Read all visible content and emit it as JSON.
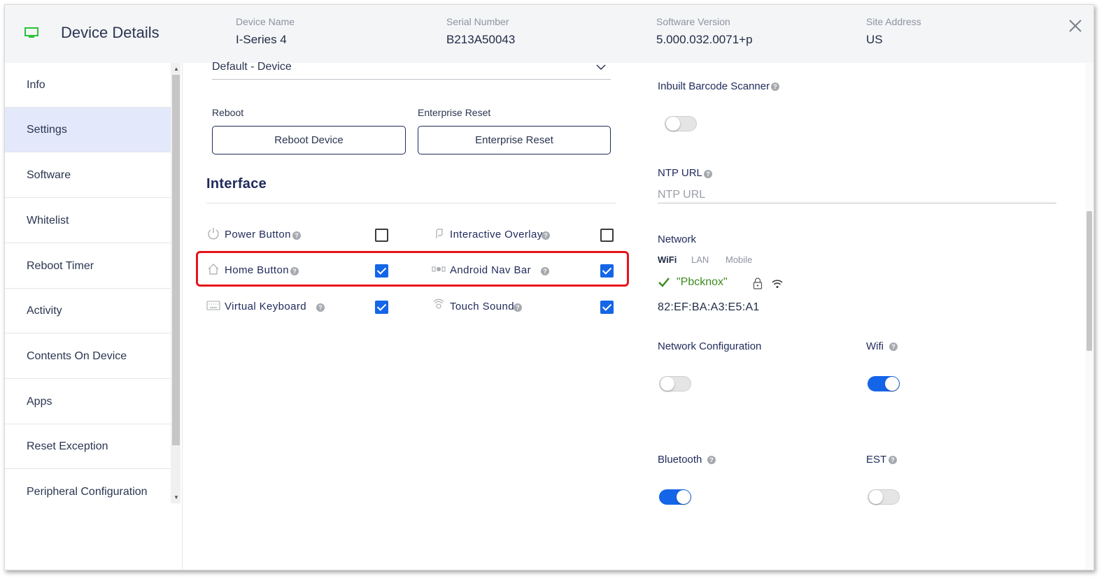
{
  "header": {
    "title": "Device Details",
    "fields": [
      {
        "label": "Device Name",
        "value": "I-Series 4"
      },
      {
        "label": "Serial Number",
        "value": "B213A50043"
      },
      {
        "label": "Software Version",
        "value": "5.000.032.0071+p"
      },
      {
        "label": "Site Address",
        "value": "US"
      }
    ],
    "icon_color": "#2cc33a"
  },
  "sidebar": {
    "items": [
      {
        "label": "Info"
      },
      {
        "label": "Settings",
        "active": true
      },
      {
        "label": "Software"
      },
      {
        "label": "Whitelist"
      },
      {
        "label": "Reboot Timer"
      },
      {
        "label": "Activity"
      },
      {
        "label": "Contents On Device"
      },
      {
        "label": "Apps"
      },
      {
        "label": "Reset Exception"
      },
      {
        "label": "Peripheral Configuration"
      }
    ]
  },
  "settings": {
    "profile_value": "Default - Device",
    "reboot_label": "Reboot",
    "reboot_button": "Reboot Device",
    "enterprise_label": "Enterprise Reset",
    "enterprise_button": "Enterprise Reset"
  },
  "interface": {
    "title": "Interface",
    "options": [
      {
        "label": "Power Button",
        "icon": "power-icon",
        "checked": false
      },
      {
        "label": "Interactive Overlay",
        "icon": "overlay-icon",
        "checked": false
      },
      {
        "label": "Home Button",
        "icon": "home-icon",
        "checked": true
      },
      {
        "label": "Android Nav Bar",
        "icon": "nav-bar-icon",
        "checked": true
      },
      {
        "label": "Virtual Keyboard",
        "icon": "keyboard-icon",
        "checked": true
      },
      {
        "label": "Touch Sound",
        "icon": "touch-sound-icon",
        "checked": true
      }
    ],
    "highlight_color": "#e8141b"
  },
  "right": {
    "barcode_label": "Inbuilt Barcode Scanner",
    "barcode_on": false,
    "ntp_label": "NTP URL",
    "ntp_placeholder": "NTP URL",
    "network_label": "Network",
    "network_tabs": [
      "WiFi",
      "LAN",
      "Mobile"
    ],
    "active_tab": "WiFi",
    "ssid": "\"Pbcknox\"",
    "mac": "82:EF:BA:A3:E5:A1",
    "net_config_label": "Network Configuration",
    "net_config_on": false,
    "wifi_label": "Wifi",
    "wifi_on": true,
    "bluetooth_label": "Bluetooth",
    "bluetooth_on": true,
    "est_label": "EST",
    "est_on": false
  },
  "colors": {
    "accent": "#1565e8",
    "active_nav": "#e3e8fa",
    "ssid_green": "#3c8a1e"
  }
}
